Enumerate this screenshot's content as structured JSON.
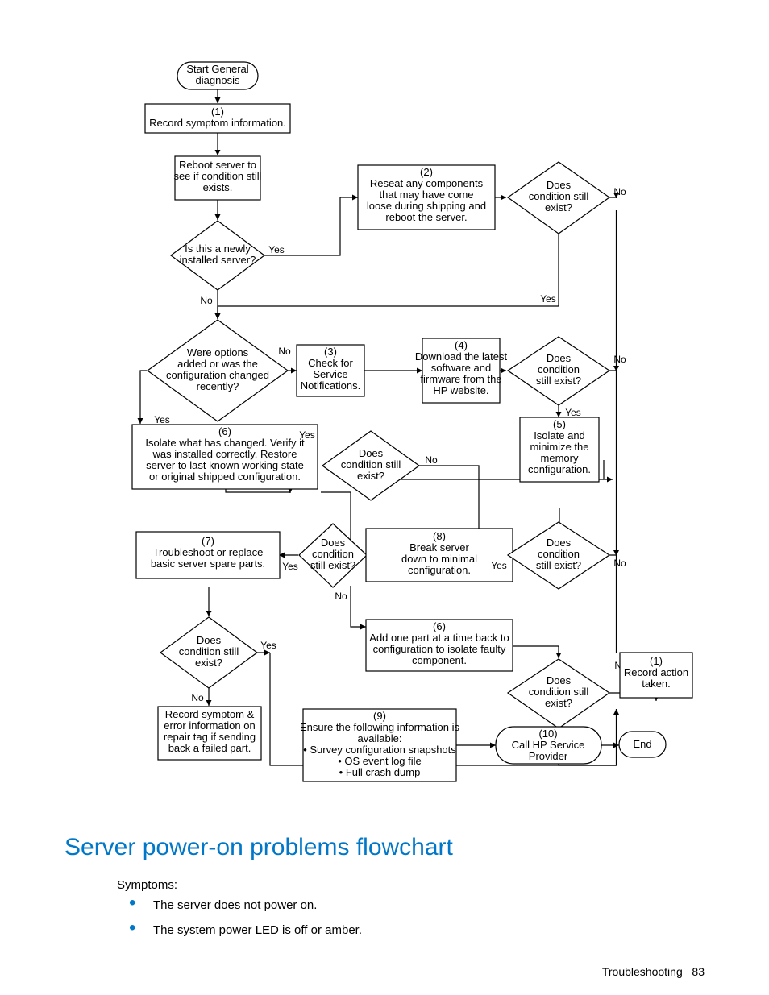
{
  "heading": "Server power-on problems flowchart",
  "symptoms_label": "Symptoms:",
  "bullets": [
    "The server does not power on.",
    "The system power LED is off or amber."
  ],
  "footer_section": "Troubleshooting",
  "footer_page": "83",
  "nodes": {
    "start": "Start General\ndiagnosis",
    "n1": "(1)\nRecord symptom information.",
    "reboot": "Reboot server to\nsee if condition still\nexists.",
    "d_new": "Is this a newly\ninstalled server?",
    "n2": "(2)\nReseat any components\nthat may have come\nloose during shipping and\nreboot the server.",
    "d_cond1": "Does\ncondition still\nexist?",
    "d_opts": "Were options\nadded or was the\nconfiguration changed\nrecently?",
    "n3": "(3)\nCheck for\nService\nNotifications.",
    "n4": "(4)\nDownload the latest\nsoftware and\nfirmware from the\nHP website.",
    "d_cond2": "Does\ncondition\nstill exist?",
    "n5": "(5)\nIsolate and\nminimize the\nmemory\nconfiguration.",
    "n6": "(6)\nIsolate what has changed. Verify it\nwas installed correctly.  Restore\nserver to last known working state\nor original shipped configuration.",
    "d_cond3": "Does\ncondition still\nexist?",
    "n7": "(7)\nTroubleshoot or replace\nbasic server spare parts.",
    "d_cond4": "Does\ncondition\nstill exist?",
    "n8": "(8)\nBreak server\ndown to minimal\nconfiguration.",
    "d_cond5": "Does\ncondition\nstill exist?",
    "d_cond6": "Does\ncondition still\nexist?",
    "n6b": "(6)\nAdd one part at a time back to\nconfiguration to isolate faulty\ncomponent.",
    "d_cond7": "Does\ncondition still\nexist?",
    "record_action": "(1)\nRecord action\ntaken.",
    "record_symptom": "Record symptom &\nerror information on\nrepair tag if sending\nback a failed part.",
    "n9": "(9)\nEnsure the following information is\navailable:\n• Survey configuration snapshots\n• OS event log file\n• Full crash dump",
    "n10": "(10)\nCall HP Service\nProvider",
    "end": "End"
  },
  "labels": {
    "yes": "Yes",
    "no": "No"
  }
}
